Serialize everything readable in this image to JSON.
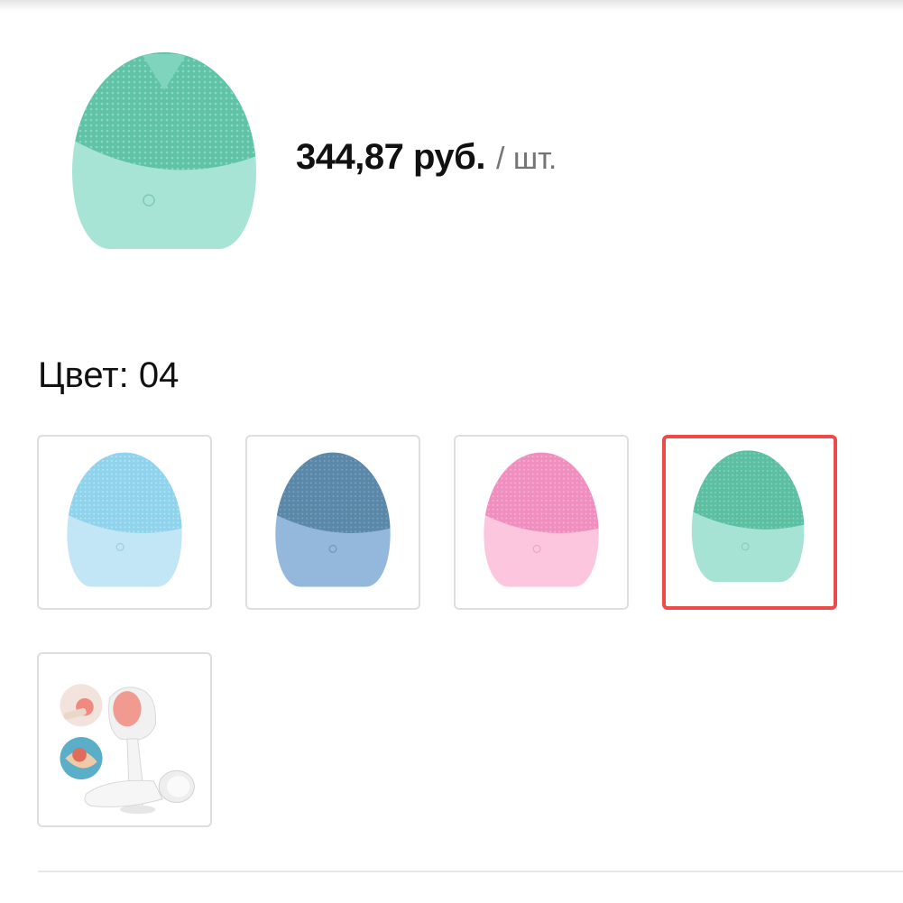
{
  "product": {
    "price": "344,87 руб.",
    "unit": "/ шт.",
    "image_icon": "face-cleansing-brush-mint"
  },
  "color": {
    "label": "Цвет: 04",
    "options": [
      {
        "name": "light-blue",
        "top_color": "#8fd3ec",
        "bottom_color": "#c2e6f5",
        "selected": false
      },
      {
        "name": "steel-blue",
        "top_color": "#5b87a8",
        "bottom_color": "#93b8dc",
        "selected": false
      },
      {
        "name": "pink",
        "top_color": "#f08fbf",
        "bottom_color": "#fbc6de",
        "selected": false
      },
      {
        "name": "mint",
        "top_color": "#5cbfa2",
        "bottom_color": "#a7e3d4",
        "selected": true
      },
      {
        "name": "manual-brush",
        "selected": false
      }
    ]
  },
  "colors": {
    "selected_border": "#ee4a4a",
    "swatch_border": "#dedede"
  }
}
